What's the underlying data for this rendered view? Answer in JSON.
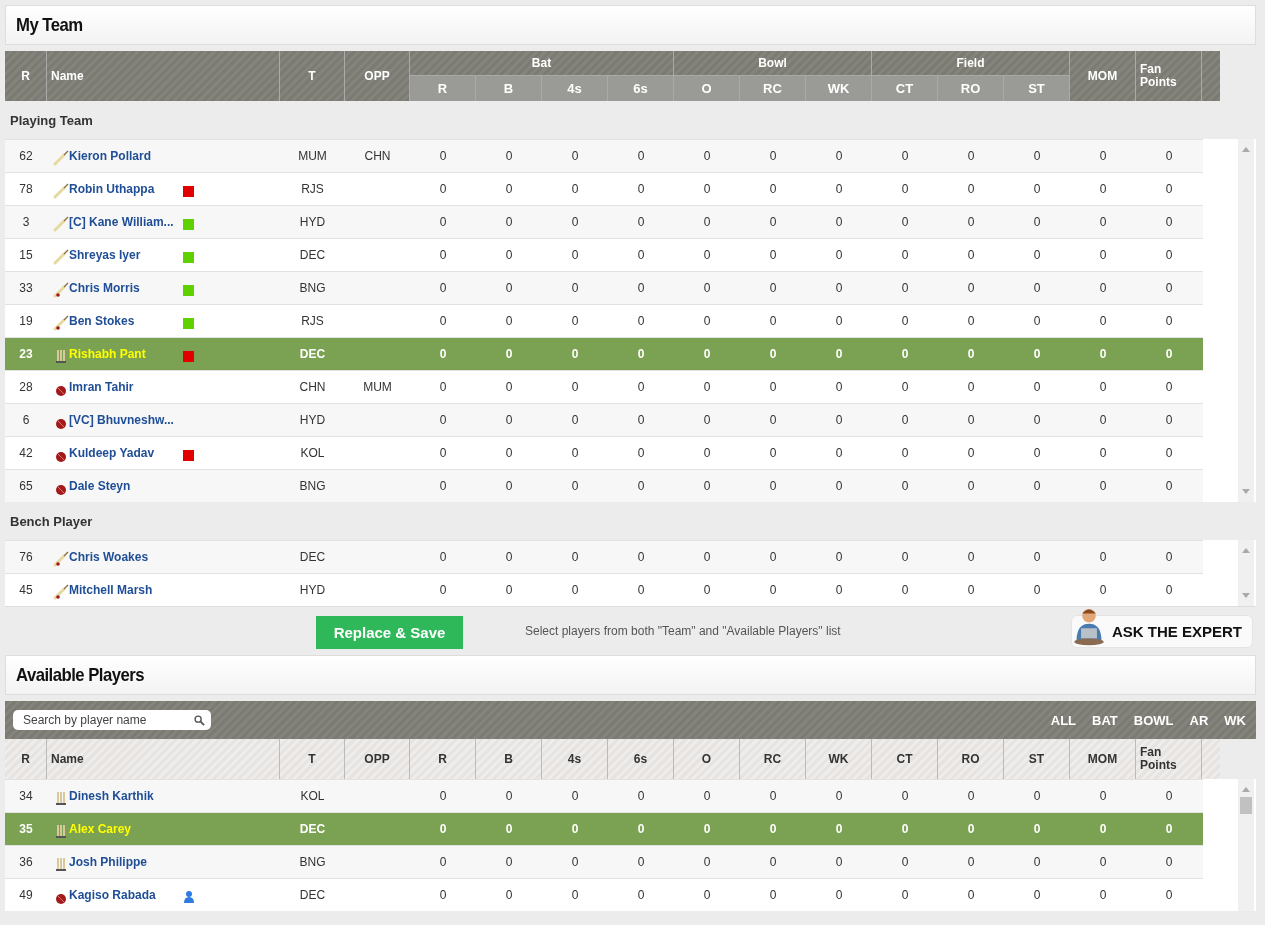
{
  "my_team": {
    "title": "My Team",
    "columns": [
      {
        "kind": "single",
        "label": "R"
      },
      {
        "kind": "single",
        "label": "Name"
      },
      {
        "kind": "single",
        "label": "T"
      },
      {
        "kind": "single",
        "label": "OPP"
      },
      {
        "kind": "group",
        "label": "Bat",
        "columns": [
          "R",
          "B",
          "4s",
          "6s"
        ]
      },
      {
        "kind": "group",
        "label": "Bowl",
        "columns": [
          "O",
          "RC",
          "WK"
        ]
      },
      {
        "kind": "group",
        "label": "Field",
        "columns": [
          "CT",
          "RO",
          "ST"
        ]
      },
      {
        "kind": "single",
        "label": "MOM"
      },
      {
        "kind": "single",
        "label": "Fan Points"
      }
    ],
    "sections": [
      {
        "title": "Playing Team",
        "rows": [
          {
            "rank": "62",
            "kind": "bat",
            "name": "Kieron Pollard",
            "team": "MUM",
            "opp": "CHN",
            "selected": false,
            "stats": [
              "0",
              "0",
              "0",
              "0",
              "0",
              "0",
              "0",
              "0",
              "0",
              "0",
              "0",
              "0"
            ]
          },
          {
            "rank": "78",
            "kind": "bat",
            "name": "Robin Uthappa",
            "badge": {
              "kind": "square",
              "color": "#e00000"
            },
            "team": "RJS",
            "selected": false,
            "stats": [
              "0",
              "0",
              "0",
              "0",
              "0",
              "0",
              "0",
              "0",
              "0",
              "0",
              "0",
              "0"
            ]
          },
          {
            "rank": "3",
            "kind": "bat",
            "name": "[C] Kane William...",
            "badge": {
              "kind": "square",
              "color": "#5fd000"
            },
            "team": "HYD",
            "selected": false,
            "stats": [
              "0",
              "0",
              "0",
              "0",
              "0",
              "0",
              "0",
              "0",
              "0",
              "0",
              "0",
              "0"
            ]
          },
          {
            "rank": "15",
            "kind": "bat",
            "name": "Shreyas Iyer",
            "badge": {
              "kind": "square",
              "color": "#5fd000"
            },
            "team": "DEC",
            "selected": false,
            "stats": [
              "0",
              "0",
              "0",
              "0",
              "0",
              "0",
              "0",
              "0",
              "0",
              "0",
              "0",
              "0"
            ]
          },
          {
            "rank": "33",
            "kind": "allrounder",
            "name": "Chris Morris",
            "badge": {
              "kind": "square",
              "color": "#5fd000"
            },
            "team": "BNG",
            "selected": false,
            "stats": [
              "0",
              "0",
              "0",
              "0",
              "0",
              "0",
              "0",
              "0",
              "0",
              "0",
              "0",
              "0"
            ]
          },
          {
            "rank": "19",
            "kind": "allrounder",
            "name": "Ben Stokes",
            "badge": {
              "kind": "square",
              "color": "#5fd000"
            },
            "team": "RJS",
            "selected": false,
            "stats": [
              "0",
              "0",
              "0",
              "0",
              "0",
              "0",
              "0",
              "0",
              "0",
              "0",
              "0",
              "0"
            ]
          },
          {
            "rank": "23",
            "kind": "keeper",
            "name": "Rishabh Pant",
            "badge": {
              "kind": "square",
              "color": "#e00000"
            },
            "team": "DEC",
            "selected": true,
            "stats": [
              "0",
              "0",
              "0",
              "0",
              "0",
              "0",
              "0",
              "0",
              "0",
              "0",
              "0",
              "0"
            ]
          },
          {
            "rank": "28",
            "kind": "bowler",
            "name": "Imran Tahir",
            "team": "CHN",
            "opp": "MUM",
            "selected": false,
            "stats": [
              "0",
              "0",
              "0",
              "0",
              "0",
              "0",
              "0",
              "0",
              "0",
              "0",
              "0",
              "0"
            ]
          },
          {
            "rank": "6",
            "kind": "bowler",
            "name": "[VC] Bhuvneshw...",
            "team": "HYD",
            "selected": false,
            "stats": [
              "0",
              "0",
              "0",
              "0",
              "0",
              "0",
              "0",
              "0",
              "0",
              "0",
              "0",
              "0"
            ]
          },
          {
            "rank": "42",
            "kind": "bowler",
            "name": "Kuldeep Yadav",
            "badge": {
              "kind": "square",
              "color": "#e00000"
            },
            "team": "KOL",
            "selected": false,
            "stats": [
              "0",
              "0",
              "0",
              "0",
              "0",
              "0",
              "0",
              "0",
              "0",
              "0",
              "0",
              "0"
            ]
          },
          {
            "rank": "65",
            "kind": "bowler",
            "name": "Dale Steyn",
            "team": "BNG",
            "selected": false,
            "stats": [
              "0",
              "0",
              "0",
              "0",
              "0",
              "0",
              "0",
              "0",
              "0",
              "0",
              "0",
              "0"
            ]
          }
        ]
      },
      {
        "title": "Bench Player",
        "rows": [
          {
            "rank": "76",
            "kind": "allrounder",
            "name": "Chris Woakes",
            "team": "DEC",
            "selected": false,
            "stats": [
              "0",
              "0",
              "0",
              "0",
              "0",
              "0",
              "0",
              "0",
              "0",
              "0",
              "0",
              "0"
            ]
          },
          {
            "rank": "45",
            "kind": "allrounder",
            "name": "Mitchell Marsh",
            "team": "HYD",
            "selected": false,
            "stats": [
              "0",
              "0",
              "0",
              "0",
              "0",
              "0",
              "0",
              "0",
              "0",
              "0",
              "0",
              "0"
            ]
          }
        ]
      }
    ]
  },
  "actions": {
    "button": "Replace & Save",
    "hint": "Select players from both \"Team\" and \"Available Players\" list",
    "expert": "ASK THE EXPERT"
  },
  "available_players": {
    "title": "Available Players",
    "search": {
      "placeholder": "Search by player name"
    },
    "filters": [
      "ALL",
      "BAT",
      "BOWL",
      "AR",
      "WK"
    ],
    "columns": [
      "R",
      "Name",
      "T",
      "OPP",
      "R",
      "B",
      "4s",
      "6s",
      "O",
      "RC",
      "WK",
      "CT",
      "RO",
      "ST",
      "MOM",
      "Fan Points"
    ],
    "rows": [
      {
        "rank": "34",
        "kind": "keeper",
        "name": "Dinesh Karthik",
        "team": "KOL",
        "selected": false,
        "stats": [
          "0",
          "0",
          "0",
          "0",
          "0",
          "0",
          "0",
          "0",
          "0",
          "0",
          "0",
          "0"
        ]
      },
      {
        "rank": "35",
        "kind": "keeper",
        "name": "Alex Carey",
        "team": "DEC",
        "selected": true,
        "stats": [
          "0",
          "0",
          "0",
          "0",
          "0",
          "0",
          "0",
          "0",
          "0",
          "0",
          "0",
          "0"
        ]
      },
      {
        "rank": "36",
        "kind": "keeper",
        "name": "Josh Philippe",
        "team": "BNG",
        "selected": false,
        "stats": [
          "0",
          "0",
          "0",
          "0",
          "0",
          "0",
          "0",
          "0",
          "0",
          "0",
          "0",
          "0"
        ]
      },
      {
        "rank": "49",
        "kind": "bowler",
        "name": "Kagiso Rabada",
        "badge": {
          "kind": "person"
        },
        "team": "DEC",
        "selected": false,
        "stats": [
          "0",
          "0",
          "0",
          "0",
          "0",
          "0",
          "0",
          "0",
          "0",
          "0",
          "0",
          "0"
        ]
      }
    ]
  }
}
